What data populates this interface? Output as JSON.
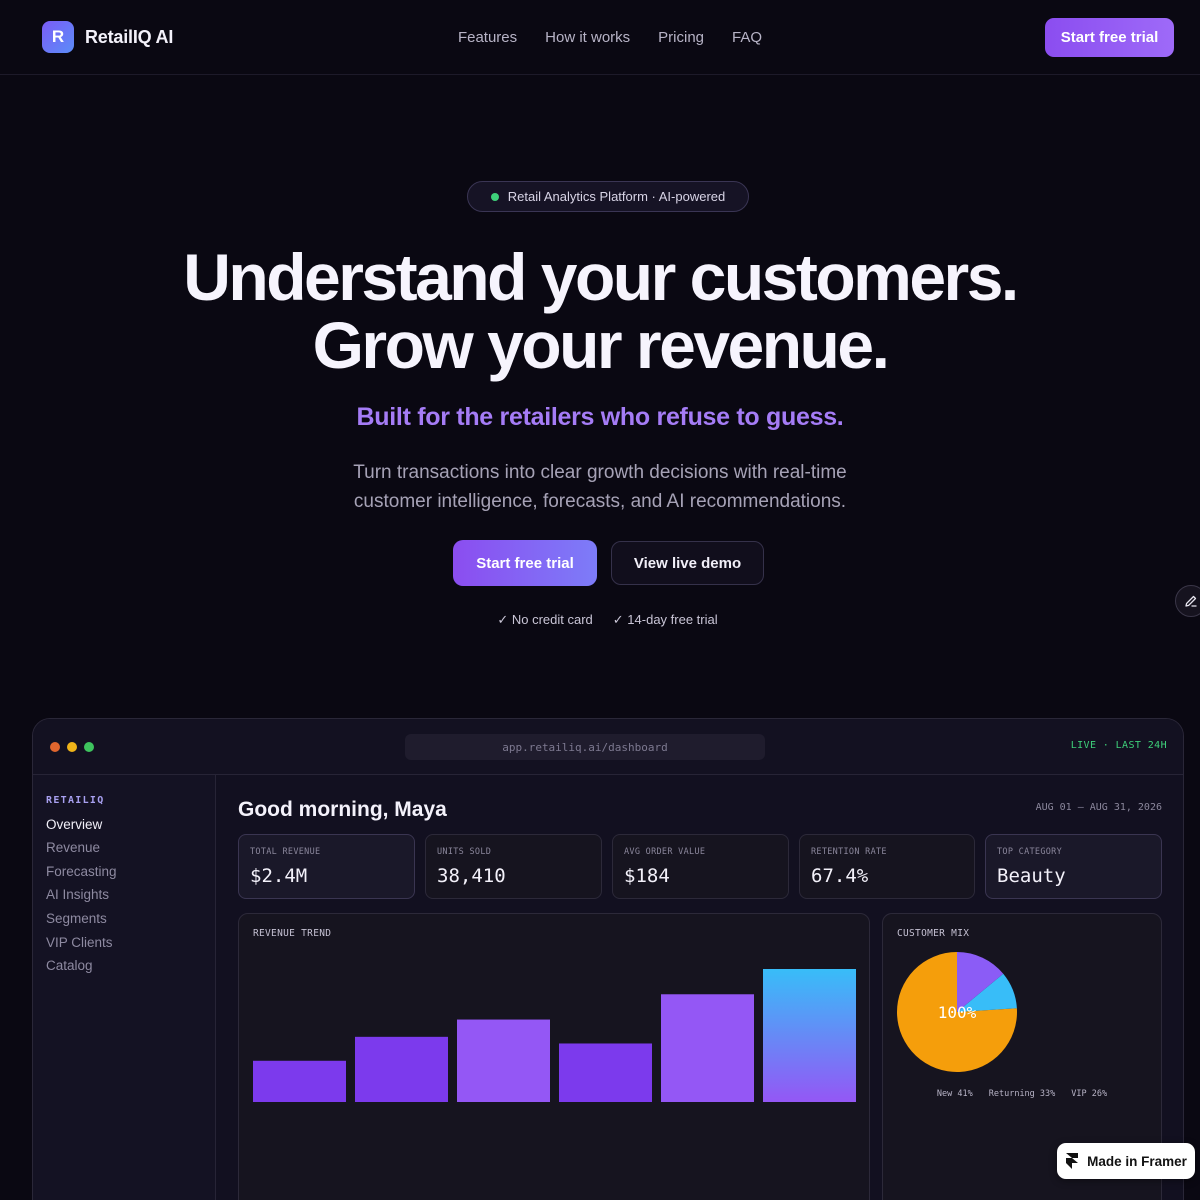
{
  "nav": {
    "logo_letter": "R",
    "brand": "RetailIQ AI",
    "links": [
      "Features",
      "How it works",
      "Pricing",
      "FAQ"
    ],
    "cta": "Start free trial"
  },
  "hero": {
    "badge": "Retail Analytics Platform · AI-powered",
    "title_line1": "Understand your customers.",
    "title_line2": "Grow your revenue.",
    "subtitle": "Built for the retailers who refuse to guess.",
    "description": "Turn transactions into clear growth decisions with real-time customer intelligence, forecasts, and AI recommendations.",
    "primary_cta": "Start free trial",
    "secondary_cta": "View live demo",
    "checks": [
      "✓ No credit card",
      "✓ 14-day free trial"
    ]
  },
  "dashboard": {
    "url": "app.retailiq.ai/dashboard",
    "live_label": "LIVE · LAST 24H",
    "window_dots": [
      "#e0662e",
      "#f0b419",
      "#3ec45e"
    ],
    "sidebar": {
      "brand": "RETAILIQ",
      "items": [
        "Overview",
        "Revenue",
        "Forecasting",
        "AI Insights",
        "Segments",
        "VIP Clients",
        "Catalog"
      ],
      "active": "Overview"
    },
    "greeting": "Good morning, Maya",
    "date_range": "AUG 01 — AUG 31, 2026",
    "kpis": [
      {
        "label": "TOTAL REVENUE",
        "value": "$2.4M"
      },
      {
        "label": "UNITS SOLD",
        "value": "38,410"
      },
      {
        "label": "AVG ORDER VALUE",
        "value": "$184"
      },
      {
        "label": "RETENTION RATE",
        "value": "67.4%"
      },
      {
        "label": "TOP CATEGORY",
        "value": "Beauty"
      }
    ],
    "revenue_title": "REVENUE TREND",
    "customer_mix_title": "CUSTOMER MIX",
    "pie_center_label": "100%",
    "pie_legend": [
      "New 41%",
      "Returning 33%",
      "VIP 26%"
    ]
  },
  "chart_data": [
    {
      "type": "bar",
      "title": "REVENUE TREND",
      "categories": [],
      "values": [
        0.31,
        0.49,
        0.62,
        0.44,
        0.81,
        1.0
      ],
      "colors": [
        "#7c3aed",
        "#7c3aed",
        "#9457f5",
        "#7c3aed",
        "#9457f5",
        "gradient"
      ]
    },
    {
      "type": "pie",
      "title": "CUSTOMER MIX",
      "slices": [
        {
          "label": "Orange",
          "value": 0.76,
          "color": "#f59e0b"
        },
        {
          "label": "Purple",
          "value": 0.14,
          "color": "#8b5cf6"
        },
        {
          "label": "Blue",
          "value": 0.1,
          "color": "#38bdf8"
        }
      ]
    }
  ],
  "footer_badge": "Made in Framer"
}
